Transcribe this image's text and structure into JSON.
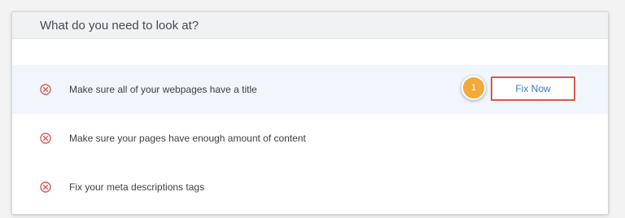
{
  "panel": {
    "title": "What do you need to look at?"
  },
  "issues": [
    {
      "label": "Make sure all of your webpages have a title",
      "icon": "circle-x-icon",
      "action_label": "Fix Now",
      "step_badge": "1",
      "highlighted": true
    },
    {
      "label": "Make sure your pages have enough amount of content",
      "icon": "circle-x-icon"
    },
    {
      "label": "Fix your meta descriptions tags",
      "icon": "circle-x-icon"
    }
  ],
  "colors": {
    "error_icon": "#e05a5a",
    "action_border": "#d75a4a",
    "action_text": "#3b78b5",
    "badge": "#f3a93a",
    "highlight_row": "#f0f6fb",
    "header_bg": "#f1f2f3"
  }
}
